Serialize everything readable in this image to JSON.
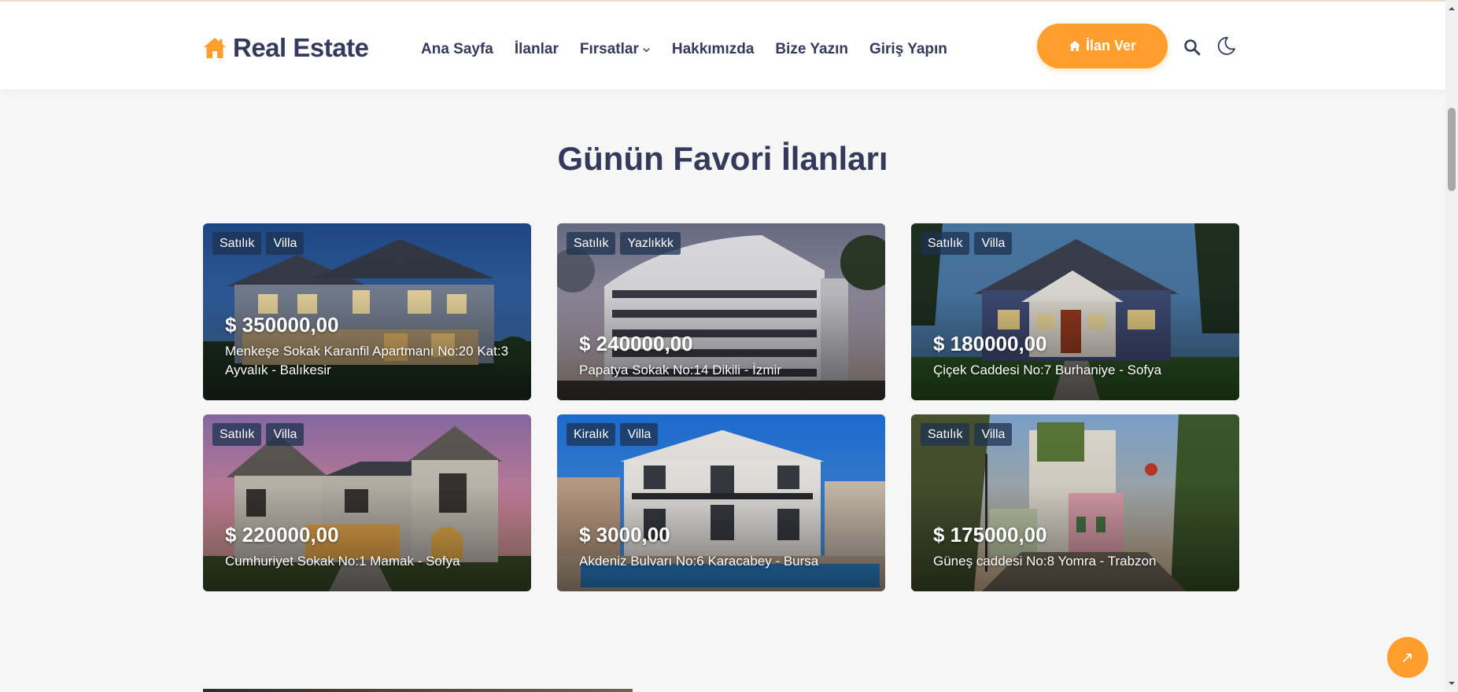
{
  "brand": {
    "name": "Real Estate",
    "icon": "home-icon",
    "accent": "#ff9e2c",
    "dark": "#353a5c"
  },
  "nav": {
    "items": [
      "Ana Sayfa",
      "İlanlar",
      "Fırsatlar",
      "Hakkımızda",
      "Bize Yazın",
      "Giriş Yapın"
    ],
    "dropdown_item_icon": "chevron-down-icon"
  },
  "header": {
    "post_button": "İlan Ver",
    "search_icon": "search-icon",
    "theme_icon": "moon-icon"
  },
  "section": {
    "title": "Günün Favori İlanları"
  },
  "listings": [
    {
      "status": "Satılık",
      "type": "Villa",
      "price": "$ 350000,00",
      "address": "Menkeşe Sokak  Karanfil Apartmanı No:20 Kat:3 Ayvalık - Balıkesir"
    },
    {
      "status": "Satılık",
      "type": "Yazlıkkk",
      "price": "$ 240000,00",
      "address": "Papatya Sokak No:14 Dikili - İzmir"
    },
    {
      "status": "Satılık",
      "type": "Villa",
      "price": "$ 180000,00",
      "address": "Çiçek Caddesi No:7 Burhaniye - Sofya"
    },
    {
      "status": "Satılık",
      "type": "Villa",
      "price": "$ 220000,00",
      "address": "Cumhuriyet Sokak No:1 Mamak - Sofya"
    },
    {
      "status": "Kiralık",
      "type": "Villa",
      "price": "$ 3000,00",
      "address": "Akdeniz Bulvarı No:6 Karacabey - Bursa"
    },
    {
      "status": "Satılık",
      "type": "Villa",
      "price": "$ 175000,00",
      "address": "Güneş caddesi No:8 Yomra - Trabzon"
    }
  ],
  "back_to_top_icon": "arrow-up-icon"
}
